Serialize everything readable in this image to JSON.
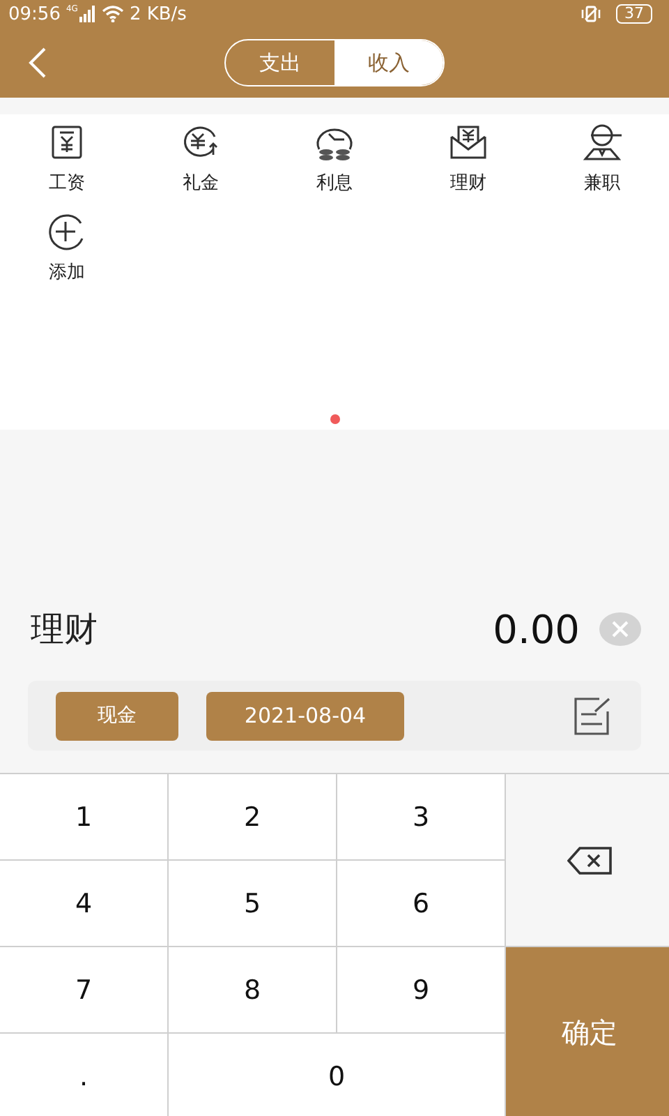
{
  "status_bar": {
    "time": "09:56",
    "network": "4G",
    "speed": "2 KB/s",
    "battery": "37"
  },
  "header": {
    "tabs": [
      {
        "label": "支出",
        "selected": false
      },
      {
        "label": "收入",
        "selected": true
      }
    ]
  },
  "categories": [
    {
      "label": "工资",
      "kind": "salary"
    },
    {
      "label": "礼金",
      "kind": "gift"
    },
    {
      "label": "利息",
      "kind": "interest"
    },
    {
      "label": "理财",
      "kind": "finance"
    },
    {
      "label": "兼职",
      "kind": "parttime"
    },
    {
      "label": "添加",
      "kind": "add"
    }
  ],
  "pager": [
    {
      "selected": true
    }
  ],
  "entry": {
    "category": "理财",
    "amount": "0.00"
  },
  "options": {
    "account": "现金",
    "date": "2021-08-04"
  },
  "keypad": [
    {
      "kind": "digit",
      "label": "1"
    },
    {
      "kind": "digit",
      "label": "2"
    },
    {
      "kind": "digit",
      "label": "3"
    },
    {
      "kind": "backspace"
    },
    {
      "kind": "digit",
      "label": "4"
    },
    {
      "kind": "digit",
      "label": "5"
    },
    {
      "kind": "digit",
      "label": "6"
    },
    {
      "kind": "digit",
      "label": "7"
    },
    {
      "kind": "digit",
      "label": "8"
    },
    {
      "kind": "digit",
      "label": "9"
    },
    {
      "kind": "confirm",
      "label": "确定"
    },
    {
      "kind": "digit",
      "label": "."
    },
    {
      "kind": "wide",
      "label": "0"
    }
  ]
}
